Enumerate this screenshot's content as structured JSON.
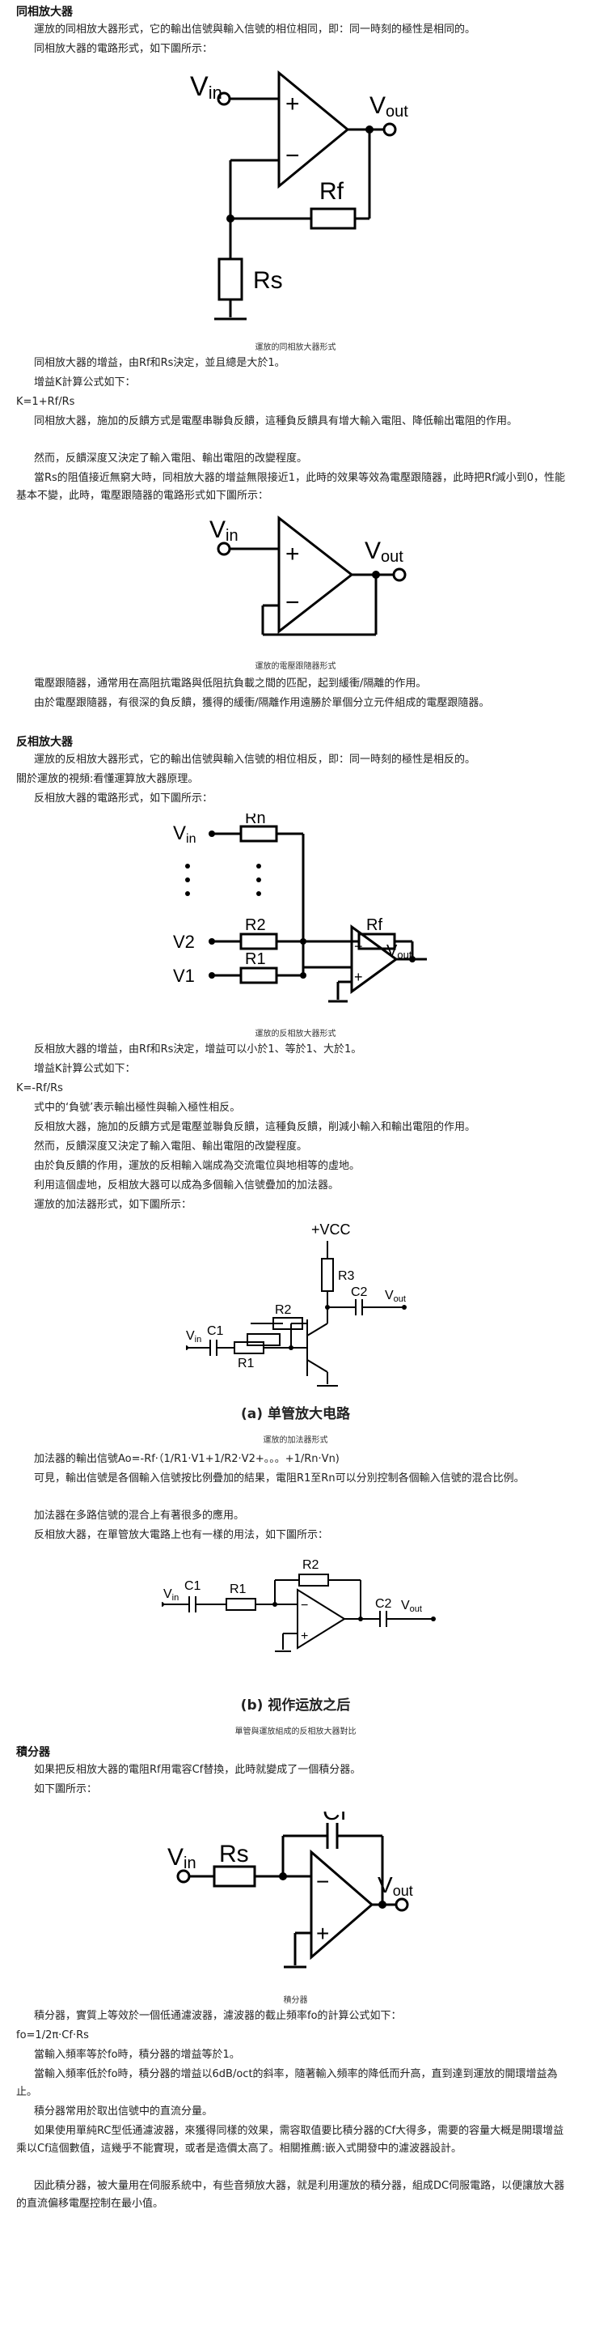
{
  "sections": {
    "noninv_title": "同相放大器",
    "inv_title": "反相放大器",
    "integ_title": "積分器"
  },
  "noninv": {
    "p1": "運放的同相放大器形式，它的輸出信號與輸入信號的相位相同，即：同一時刻的極性是相同的。",
    "p2": "同相放大器的電路形式，如下圖所示：",
    "cap1": "運放的同相放大器形式",
    "p3": "同相放大器的增益，由Rf和Rs決定，並且總是大於1。",
    "p4": "增益K計算公式如下：",
    "formula": "K=1+Rf/Rs",
    "p5": "同相放大器，施加的反饋方式是電壓串聯負反饋，這種負反饋具有增大輸入電阻、降低輸出電阻的作用。",
    "p6": "然而，反饋深度又決定了輸入電阻、輸出電阻的改變程度。",
    "p7": "當Rs的阻值接近無窮大時，同相放大器的增益無限接近1，此時的效果等效為電壓跟隨器，此時把Rf減小到0，性能基本不變，此時，電壓跟隨器的電路形式如下圖所示：",
    "cap2": "運放的電壓跟隨器形式",
    "p8": "電壓跟隨器，通常用在高阻抗電路與低阻抗負載之間的匹配，起到緩衝/隔離的作用。",
    "p9": "由於電壓跟隨器，有很深的負反饋，獲得的緩衝/隔離作用遠勝於單個分立元件組成的電壓跟隨器。"
  },
  "inv": {
    "p1": "運放的反相放大器形式，它的輸出信號與輸入信號的相位相反，即：同一時刻的極性是相反的。",
    "p2": "關於運放的視頻:看懂運算放大器原理。",
    "p3": "反相放大器的電路形式，如下圖所示：",
    "cap1": "運放的反相放大器形式",
    "p4": "反相放大器的增益，由Rf和Rs決定，增益可以小於1、等於1、大於1。",
    "p5": "增益K計算公式如下：",
    "formula": "K=-Rf/Rs",
    "p6": "式中的‘負號’表示輸出極性與輸入極性相反。",
    "p7": "反相放大器，施加的反饋方式是電壓並聯負反饋，這種負反饋，削減小輸入和輸出電阻的作用。",
    "p8": "然而，反饋深度又決定了輸入電阻、輸出電阻的改變程度。",
    "p9": "由於負反饋的作用，運放的反相輸入端成為交流電位與地相等的虛地。",
    "p10": "利用這個虛地，反相放大器可以成為多個輸入信號疊加的加法器。",
    "p11": "運放的加法器形式，如下圖所示：",
    "capb1": "(a) 单管放大电路",
    "cap2": "運放的加法器形式",
    "p12": "加法器的輸出信號Ao=-Rf·（1/R1·V1+1/R2·V2+。。。+1/Rn·Vn)",
    "p13": "可見，輸出信號是各個輸入信號按比例疊加的結果，電阻R1至Rn可以分別控制各個輸入信號的混合比例。",
    "p14": "加法器在多路信號的混合上有著很多的應用。",
    "p15": "反相放大器，在單管放大電路上也有一樣的用法，如下圖所示：",
    "capb2": "(b) 视作运放之后",
    "cap3": "單管與運放組成的反相放大器對比"
  },
  "integ": {
    "p1": "如果把反相放大器的電阻Rf用電容Cf替換，此時就變成了一個積分器。",
    "p2": "如下圖所示：",
    "cap1": "積分器",
    "p3": "積分器，實質上等效於一個低通濾波器，濾波器的截止頻率fo的計算公式如下：",
    "formula": "fo=1/2π·Cf·Rs",
    "p4": "當輸入頻率等於fo時，積分器的增益等於1。",
    "p5": "當輸入頻率低於fo時，積分器的增益以6dB/oct的斜率，隨著輸入頻率的降低而升高，直到達到運放的開環增益為止。",
    "p6": "積分器常用於取出信號中的直流分量。",
    "p7": "如果使用單純RC型低通濾波器，來獲得同樣的效果，需容取值要比積分器的Cf大得多，需要的容量大概是開環增益乘以Cf這個數值，這幾乎不能實現，或者是造價太高了。相關推薦:嵌入式開發中的濾波器設計。",
    "p8": "因此積分器，被大量用在伺服系統中，有些音頻放大器，就是利用運放的積分器，組成DC伺服電路，以便讓放大器的直流偏移電壓控制在最小值。"
  },
  "labels": {
    "vin": "V",
    "in": "in",
    "vout": "V",
    "out": "out",
    "rf": "Rf",
    "rs": "Rs",
    "rn": "Rn",
    "r1": "R1",
    "r2": "R2",
    "r3": "R3",
    "v1": "V1",
    "v2": "V2",
    "vcc": "+VCC",
    "c1": "C1",
    "c2": "C2",
    "cf": "Cf",
    "plus": "+",
    "minus": "−"
  }
}
